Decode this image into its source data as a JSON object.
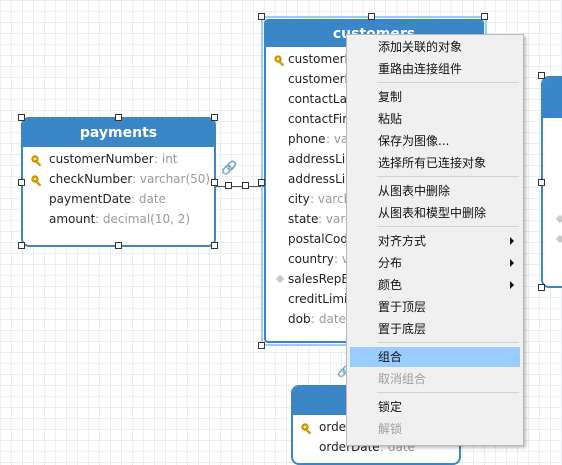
{
  "payments": {
    "title": "payments",
    "fields": [
      {
        "name": "customerNumber",
        "type": " : int",
        "icon": "key-icon"
      },
      {
        "name": "checkNumber",
        "type": " : varchar(50)",
        "icon": "key-icon"
      },
      {
        "name": "paymentDate",
        "type": " : date",
        "icon": ""
      },
      {
        "name": "amount",
        "type": " : decimal(10, 2)",
        "icon": ""
      }
    ]
  },
  "customers": {
    "title": "customers",
    "fields": [
      {
        "name": "customerN",
        "type": "",
        "icon": "key-icon"
      },
      {
        "name": "customerN",
        "type": "",
        "icon": ""
      },
      {
        "name": "contactLas",
        "type": "",
        "icon": ""
      },
      {
        "name": "contactFirs",
        "type": "",
        "icon": ""
      },
      {
        "name": "phone",
        "type": " : va",
        "icon": ""
      },
      {
        "name": "addressLin",
        "type": "",
        "icon": ""
      },
      {
        "name": "addressLin",
        "type": "",
        "icon": ""
      },
      {
        "name": "city",
        "type": " : varch",
        "icon": ""
      },
      {
        "name": "state",
        "type": " : varc",
        "icon": ""
      },
      {
        "name": "postalCod",
        "type": "",
        "icon": ""
      },
      {
        "name": "country",
        "type": " : v",
        "icon": ""
      },
      {
        "name": "salesRepE",
        "type": "",
        "icon": "diamond-icon"
      },
      {
        "name": "creditLimit",
        "type": "",
        "icon": ""
      },
      {
        "name": "dob",
        "type": " : date",
        "icon": ""
      }
    ]
  },
  "orders": {
    "fields": [
      {
        "name": "order",
        "type": "",
        "icon": "key-icon"
      },
      {
        "name": "orderDate",
        "type": " : date",
        "icon": ""
      }
    ]
  },
  "context_menu": {
    "items": [
      {
        "label": "添加关联的对象",
        "disabled": false,
        "submenu": false
      },
      {
        "label": "重路由连接组件",
        "disabled": false,
        "submenu": false
      },
      {
        "label": "复制",
        "disabled": false,
        "submenu": false
      },
      {
        "label": "粘贴",
        "disabled": false,
        "submenu": false
      },
      {
        "label": "保存为图像...",
        "disabled": false,
        "submenu": false
      },
      {
        "label": "选择所有已连接对象",
        "disabled": false,
        "submenu": false
      },
      {
        "label": "从图表中删除",
        "disabled": false,
        "submenu": false
      },
      {
        "label": "从图表和模型中删除",
        "disabled": false,
        "submenu": false
      },
      {
        "label": "对齐方式",
        "disabled": false,
        "submenu": true
      },
      {
        "label": "分布",
        "disabled": false,
        "submenu": true
      },
      {
        "label": "颜色",
        "disabled": false,
        "submenu": true
      },
      {
        "label": "置于顶层",
        "disabled": false,
        "submenu": false
      },
      {
        "label": "置于底层",
        "disabled": false,
        "submenu": false
      },
      {
        "label": "组合",
        "disabled": false,
        "submenu": false,
        "highlighted": true
      },
      {
        "label": "取消组合",
        "disabled": true,
        "submenu": false
      },
      {
        "label": "锁定",
        "disabled": false,
        "submenu": false
      },
      {
        "label": "解锁",
        "disabled": true,
        "submenu": false
      }
    ]
  },
  "colors": {
    "entity_header": "#3b86c6",
    "selection_border": "#99ccff",
    "menu_highlight": "#99ccff",
    "key_icon": "#e8a800"
  }
}
